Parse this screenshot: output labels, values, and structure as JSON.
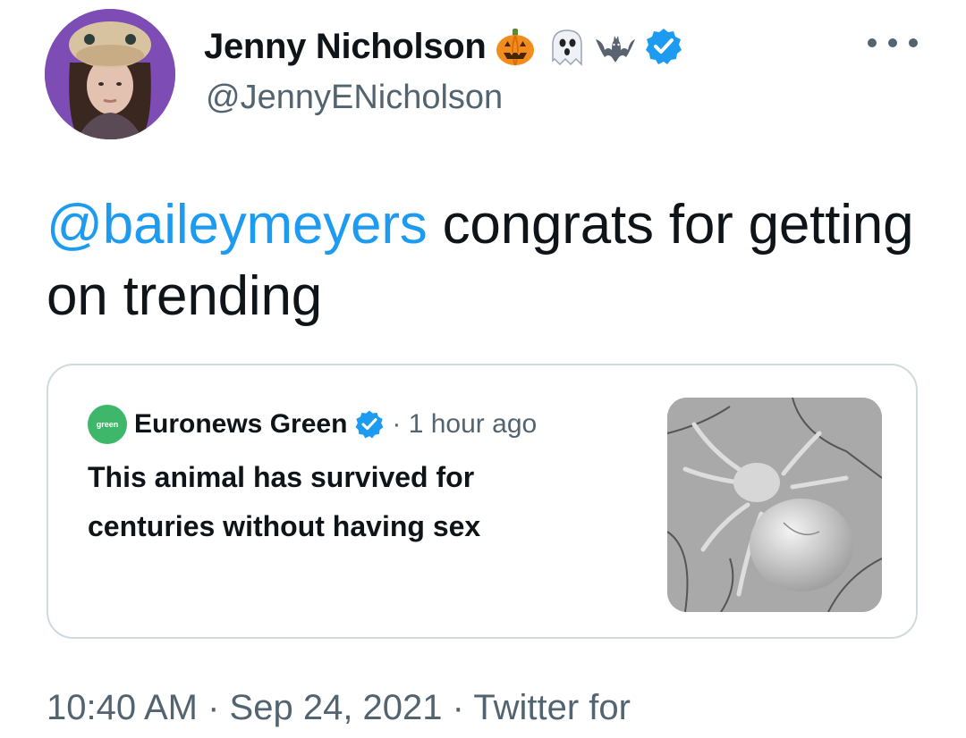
{
  "author": {
    "display_name": "Jenny Nicholson",
    "handle": "@JennyENicholson",
    "name_emojis": [
      "pumpkin-emoji",
      "ghost-emoji",
      "bat-emoji"
    ],
    "verified_icon": "verified-badge-icon"
  },
  "tweet": {
    "mention": "@baileymeyers",
    "text_rest": " congrats for getting on trending"
  },
  "quote": {
    "source_name": "Euronews Green",
    "logo_text": "green",
    "separator_time": "· 1 hour ago",
    "headline": "This animal has survived for centuries without having sex",
    "image_subject": "mite-micrograph"
  },
  "footer": {
    "meta": "10:40 AM · Sep 24, 2021 · Twitter for"
  },
  "colors": {
    "link": "#1d9bf0",
    "secondary_text": "#536471",
    "border": "#cfd9de",
    "verified": "#1d9bf0"
  }
}
